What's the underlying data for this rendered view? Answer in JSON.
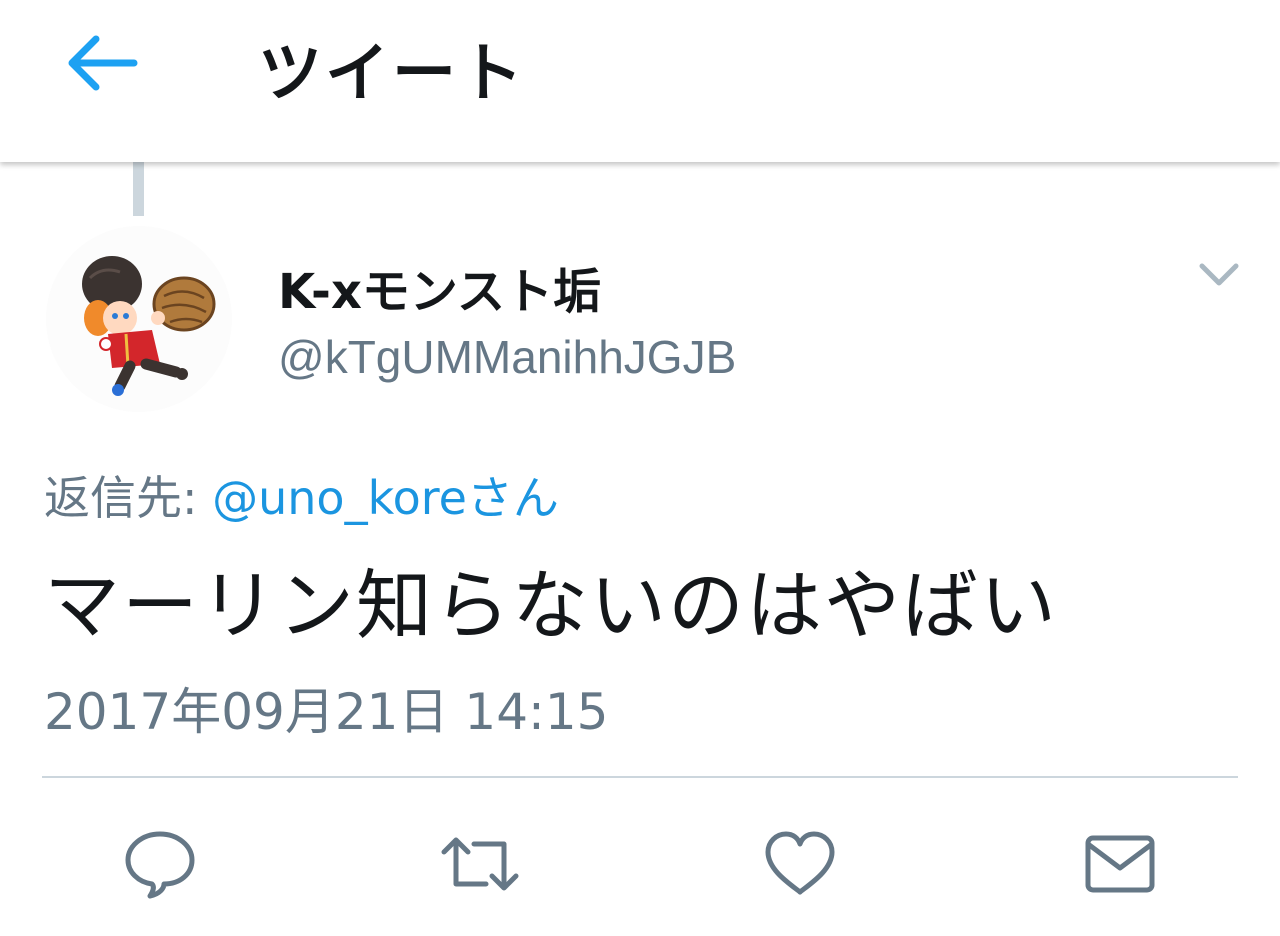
{
  "header": {
    "title": "ツイート",
    "back_icon": "arrow-left-icon",
    "accent": "#1da1f2"
  },
  "tweet": {
    "author": {
      "display_name": "K-xモンスト垢",
      "handle": "@kTgUMManihhJGJB"
    },
    "reply_to": {
      "prefix": "返信先: ",
      "mention": "@uno_kore",
      "suffix": "さん"
    },
    "text": "マーリン知らないのはやばい",
    "timestamp": "2017年09月21日 14:15"
  },
  "actions": [
    {
      "name": "reply",
      "icon": "reply-icon"
    },
    {
      "name": "retweet",
      "icon": "retweet-icon"
    },
    {
      "name": "like",
      "icon": "heart-icon"
    },
    {
      "name": "share-dm",
      "icon": "envelope-icon"
    }
  ],
  "colors": {
    "text": "#14171a",
    "secondary": "#657786",
    "link": "#1b95e0",
    "divider": "#ccd6dd"
  }
}
